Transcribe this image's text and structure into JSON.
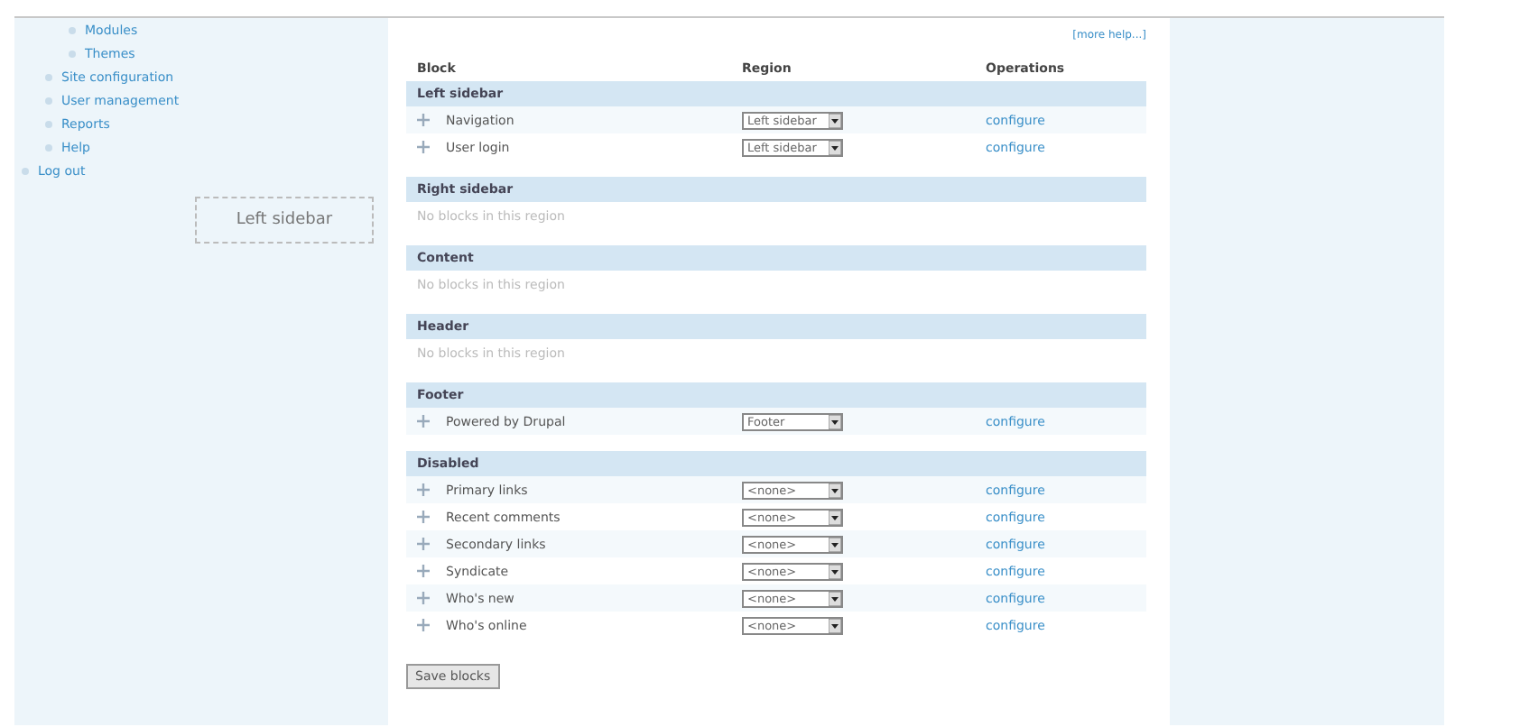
{
  "sidebar": {
    "items": [
      {
        "children": [
          {
            "children": [
              {
                "label": "Modules"
              },
              {
                "label": "Themes"
              }
            ]
          },
          {
            "label": "Site configuration"
          },
          {
            "label": "User management"
          },
          {
            "label": "Reports"
          },
          {
            "label": "Help"
          }
        ]
      },
      {
        "label": "Log out"
      }
    ],
    "region_placeholder": "Left sidebar"
  },
  "help_link": "[more help...]",
  "table": {
    "columns": [
      "Block",
      "Region",
      "Operations"
    ],
    "regions": [
      {
        "name": "Left sidebar",
        "blocks": [
          {
            "name": "Navigation",
            "region": "Left sidebar",
            "operation": "configure"
          },
          {
            "name": "User login",
            "region": "Left sidebar",
            "operation": "configure"
          }
        ]
      },
      {
        "name": "Right sidebar",
        "empty_text": "No blocks in this region"
      },
      {
        "name": "Content",
        "empty_text": "No blocks in this region"
      },
      {
        "name": "Header",
        "empty_text": "No blocks in this region"
      },
      {
        "name": "Footer",
        "blocks": [
          {
            "name": "Powered by Drupal",
            "region": "Footer",
            "operation": "configure"
          }
        ]
      },
      {
        "name": "Disabled",
        "blocks": [
          {
            "name": "Primary links",
            "region": "<none>",
            "operation": "configure"
          },
          {
            "name": "Recent comments",
            "region": "<none>",
            "operation": "configure"
          },
          {
            "name": "Secondary links",
            "region": "<none>",
            "operation": "configure"
          },
          {
            "name": "Syndicate",
            "region": "<none>",
            "operation": "configure"
          },
          {
            "name": "Who's new",
            "region": "<none>",
            "operation": "configure"
          },
          {
            "name": "Who's online",
            "region": "<none>",
            "operation": "configure"
          }
        ]
      }
    ]
  },
  "save_button": "Save blocks"
}
